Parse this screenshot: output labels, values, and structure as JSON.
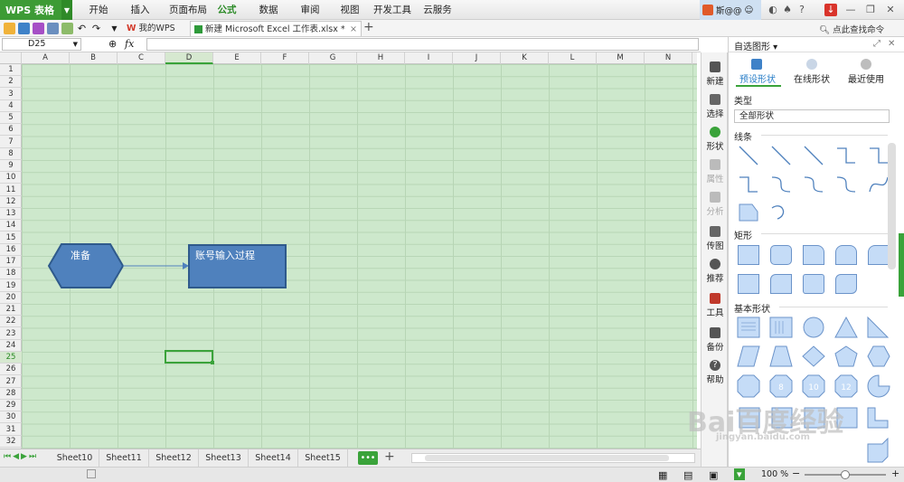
{
  "app": {
    "title": "WPS 表格"
  },
  "menu": [
    "开始",
    "插入",
    "页面布局",
    "公式",
    "数据",
    "审阅",
    "视图",
    "开发工具",
    "云服务"
  ],
  "user": {
    "name": "斯@@"
  },
  "search": {
    "label": "点此查找命令"
  },
  "doc_tabs": [
    {
      "label": "我的WPS"
    },
    {
      "label": "新建 Microsoft Excel 工作表.xlsx *"
    }
  ],
  "formula_bar": {
    "cell_ref": "D25",
    "fx": "fx",
    "formula": ""
  },
  "columns": [
    "A",
    "B",
    "C",
    "D",
    "E",
    "F",
    "G",
    "H",
    "I",
    "J",
    "K",
    "L",
    "M",
    "N"
  ],
  "rows": [
    "1",
    "2",
    "3",
    "4",
    "5",
    "6",
    "7",
    "8",
    "9",
    "10",
    "11",
    "12",
    "13",
    "14",
    "15",
    "16",
    "17",
    "18",
    "19",
    "20",
    "21",
    "22",
    "23",
    "24",
    "25",
    "26",
    "27",
    "28",
    "29",
    "30",
    "31",
    "32"
  ],
  "shapes": {
    "hexagon_text": "准备",
    "process_text": "账号输入过程"
  },
  "sheets": [
    "Sheet10",
    "Sheet11",
    "Sheet12",
    "Sheet13",
    "Sheet14",
    "Sheet15"
  ],
  "sheet_more": "•••",
  "status": {
    "zoom": "100 %"
  },
  "rail": [
    {
      "label": "新建"
    },
    {
      "label": "选择"
    },
    {
      "label": "形状"
    },
    {
      "label": "属性"
    },
    {
      "label": "分析"
    },
    {
      "label": "传图"
    },
    {
      "label": "推荐"
    },
    {
      "label": "工具"
    },
    {
      "label": "备份"
    },
    {
      "label": "帮助"
    }
  ],
  "panel": {
    "title": "自选图形 ▾",
    "tabs": [
      "预设形状",
      "在线形状",
      "最近使用"
    ],
    "type_label": "类型",
    "type_value": "全部形状",
    "sections": [
      "线条",
      "矩形",
      "基本形状"
    ],
    "basic_numbers": [
      "8",
      "10",
      "12"
    ]
  },
  "colors": {
    "accent": "#3aa33a",
    "shape_fill": "#4f81bd",
    "shape_stroke": "#2f5a8c",
    "grid": "#cde8cc"
  },
  "watermark": {
    "text": "Bai百度经验",
    "url": "jingyan.baidu.com"
  }
}
